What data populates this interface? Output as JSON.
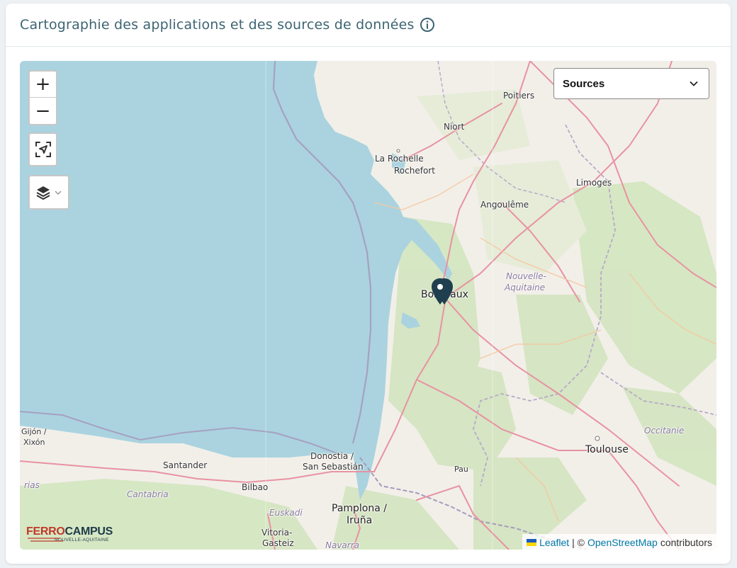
{
  "card": {
    "title": "Cartographie des applications et des sources de données"
  },
  "icons": {
    "info": "info-icon",
    "locate": "locate-icon",
    "layers": "layers-icon",
    "chevron": "chevron-down-icon",
    "marker": "map-marker-icon"
  },
  "map": {
    "zoom_in_label": "+",
    "zoom_out_label": "−",
    "select": {
      "selected": "Sources"
    },
    "places": {
      "poitiers": "Poitiers",
      "niort": "Niort",
      "la_rochelle": "La Rochelle",
      "rochefort": "Rochefort",
      "limoges": "Limoges",
      "angouleme": "Angoulême",
      "nouvelle_aquitaine_1": "Nouvelle-",
      "nouvelle_aquitaine_2": "Aquitaine",
      "bordeaux": "Bordeaux",
      "gijon_1": "Gijón /",
      "gijon_2": "Xixón",
      "occitanie": "Occitanie",
      "toulouse": "Toulouse",
      "donostia_1": "Donostia /",
      "donostia_2": "San Sebastián",
      "santander": "Santander",
      "bilbao": "Bilbao",
      "cantabria": "Cantabria",
      "pau": "Pau",
      "euskadi": "Euskadi",
      "pamplona_1": "Pamplona /",
      "pamplona_2": "Iruña",
      "vitoria_1": "Vitoria-",
      "vitoria_2": "Gasteiz",
      "navarra": "Navarra",
      "asturias": "rias"
    },
    "logo": {
      "part1": "FERRO",
      "part2": "CAMPUS",
      "sub": "NOUVELLE-AQUITAINE"
    },
    "attribution": {
      "leaflet": "Leaflet",
      "sep": " | © ",
      "osm": "OpenStreetMap",
      "suffix": "contributors"
    }
  },
  "colors": {
    "sea": "#aad3df",
    "land": "#f2efe9",
    "forest": "#d6e6c2",
    "road": "#e892a2",
    "border": "#a59bbd",
    "marker": "#1f3e4e",
    "title": "#3d6472"
  }
}
